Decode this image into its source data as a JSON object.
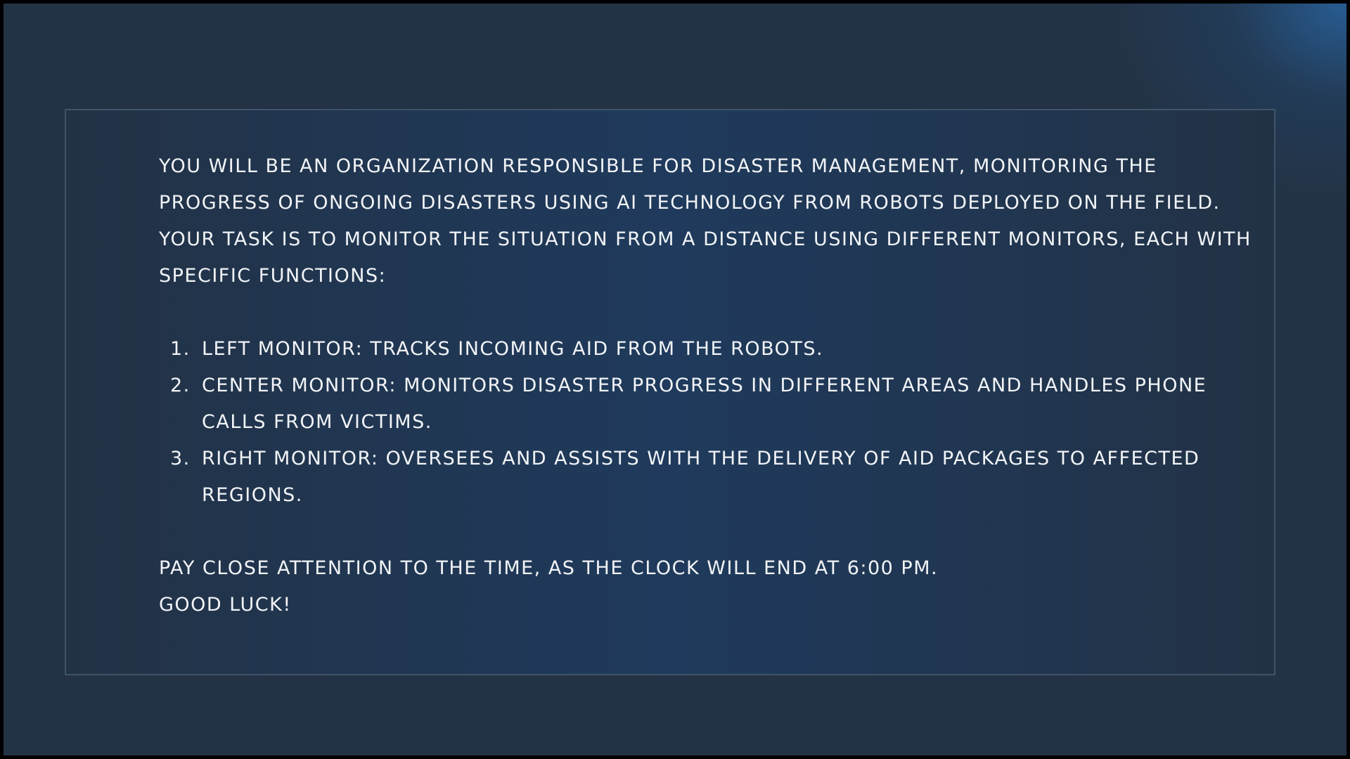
{
  "briefing": {
    "intro": "You will be an organization responsible for disaster management, monitoring the progress of ongoing disasters using AI technology from robots deployed on the field. Your task is to monitor the situation from a distance using different monitors, each with specific functions:",
    "steps": [
      {
        "number": "1.",
        "text": "Left Monitor: Tracks incoming aid from the robots."
      },
      {
        "number": "2.",
        "text": "Center Monitor: Monitors disaster progress in different areas and handles phone calls from victims."
      },
      {
        "number": "3.",
        "text": "Right Monitor: Oversees and assists with the delivery of aid packages to affected regions."
      }
    ],
    "warning": "Pay close attention to the time, as the clock will end at 6:00 PM.",
    "farewell": "Good luck!"
  }
}
